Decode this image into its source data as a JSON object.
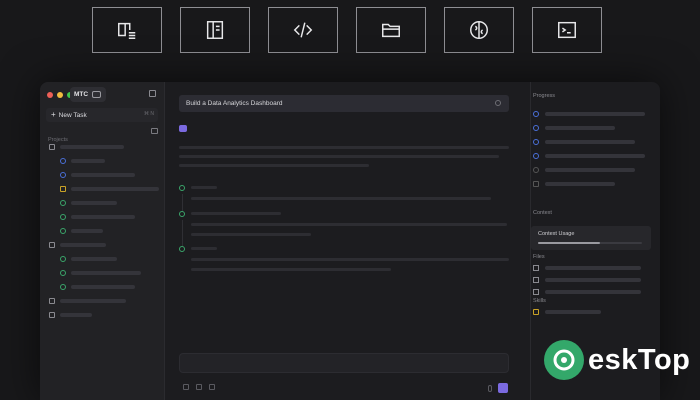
{
  "features": [
    {
      "icon": "book-list-icon"
    },
    {
      "icon": "document-icon"
    },
    {
      "icon": "code-icon"
    },
    {
      "icon": "folder-open-icon"
    },
    {
      "icon": "brain-icon"
    },
    {
      "icon": "terminal-icon"
    }
  ],
  "app": {
    "name": "MTC",
    "new_task_label": "New Task",
    "new_task_shortcut": "⌘ N",
    "projects_label": "Projects"
  },
  "main": {
    "task_title": "Build a Data Analytics Dashboard"
  },
  "right_panel": {
    "progress_label": "Progress",
    "context_label": "Context",
    "context_usage_label": "Context Usage",
    "context_usage_fraction": 0.6,
    "files_label": "Files",
    "skills_label": "Skills"
  },
  "colors": {
    "accent": "#7b6ae0",
    "success": "#3aa56a",
    "warning": "#c9a227",
    "progress_blue": "#4a6fd8"
  },
  "watermark": {
    "text": "eskTop"
  }
}
